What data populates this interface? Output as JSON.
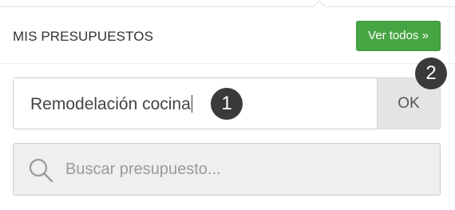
{
  "header": {
    "title": "MIS PRESUPUESTOS",
    "view_all_label": "Ver todos »"
  },
  "budget_form": {
    "name_value": "Remodelación cocina",
    "ok_label": "OK"
  },
  "search": {
    "placeholder": "Buscar presupuesto..."
  },
  "annotations": {
    "step_1": "1",
    "step_2": "2"
  },
  "colors": {
    "view_all_green": "#46a543",
    "badge_dark": "#3a3a3a",
    "ok_gray": "#e4e4e4",
    "search_bg": "#efefef"
  },
  "icons": {
    "search": "search-icon"
  }
}
